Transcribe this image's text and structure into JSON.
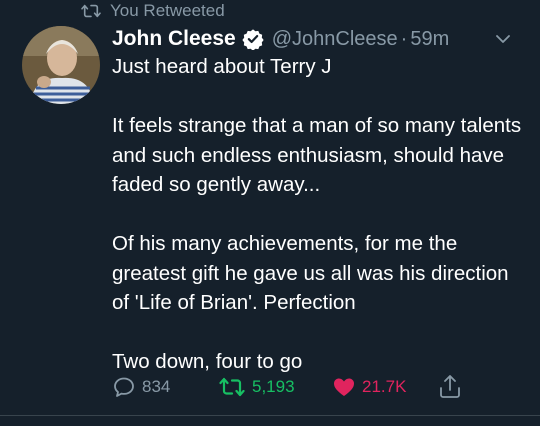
{
  "retweet_context": {
    "label": "You Retweeted",
    "icon": "retweet-icon"
  },
  "tweet": {
    "author_name": "John Cleese",
    "handle": "@JohnCleese",
    "separator": "·",
    "time": "59m",
    "verified_icon": "verified-badge-icon",
    "paragraphs": [
      "Just heard about Terry J",
      "It feels strange that a man of so many talents and such endless enthusiasm, should have faded so gently away...",
      "Of his many achievements, for me the greatest gift he gave us all was his direction of 'Life of Brian'. Perfection",
      "Two down, four to go"
    ],
    "stats": {
      "replies": "834",
      "retweets": "5,193",
      "likes": "21.7K"
    }
  },
  "colors": {
    "background": "#15202b",
    "secondary_text": "#8899a6",
    "retweet_active": "#17bf63",
    "like_active": "#e0245e",
    "verified": "#ffffff"
  }
}
